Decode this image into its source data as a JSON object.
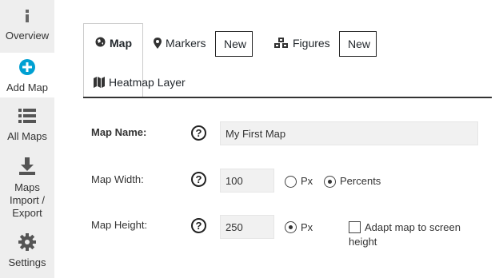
{
  "sidebar": {
    "items": [
      {
        "label": "Overview",
        "icon": "info-icon"
      },
      {
        "label": "Add Map",
        "icon": "plus-circle-icon",
        "active": true
      },
      {
        "label": "All Maps",
        "icon": "list-icon"
      },
      {
        "label": "Maps Import / Export",
        "icon": "download-icon"
      },
      {
        "label": "Settings",
        "icon": "gear-icon"
      }
    ]
  },
  "tabs": {
    "map": "Map",
    "markers": "Markers",
    "markers_new": "New",
    "figures": "Figures",
    "figures_new": "New",
    "heatmap": "Heatmap Layer"
  },
  "form": {
    "map_name_label": "Map Name:",
    "map_name_value": "My First Map",
    "map_width_label": "Map Width:",
    "map_width_value": "100",
    "width_px_label": "Px",
    "width_percents_label": "Percents",
    "width_unit_selected": "Percents",
    "map_height_label": "Map Height:",
    "map_height_value": "250",
    "height_px_label": "Px",
    "height_unit_selected": "Px",
    "adapt_label": "Adapt map to screen height",
    "adapt_checked": false,
    "help_glyph": "?"
  },
  "colors": {
    "accent": "#00a0d2",
    "sidebar_bg": "#eeeeee"
  }
}
